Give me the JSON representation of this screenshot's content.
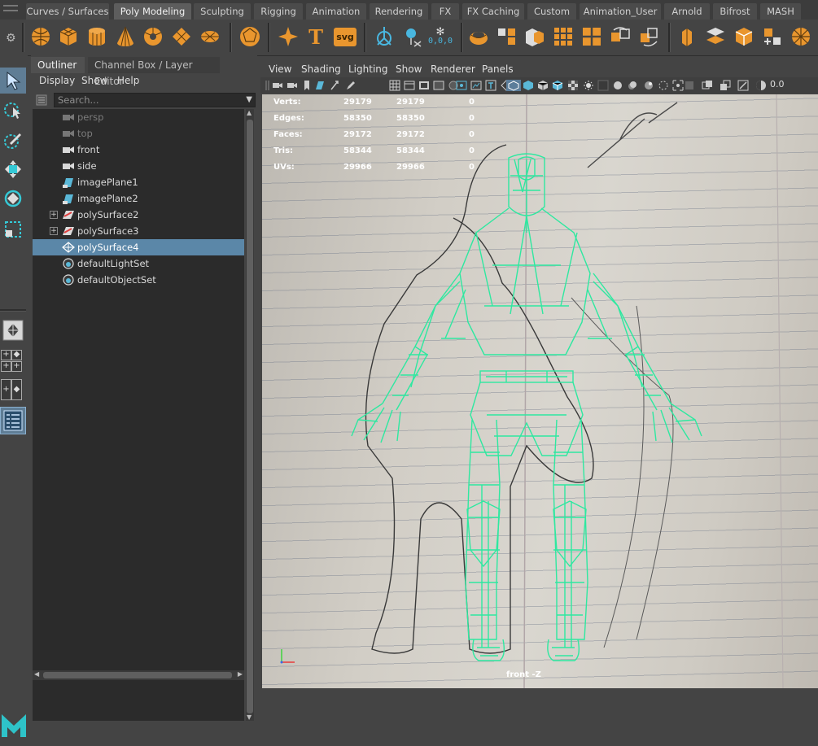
{
  "shelf": {
    "tabs": [
      "Curves / Surfaces",
      "Poly Modeling",
      "Sculpting",
      "Rigging",
      "Animation",
      "Rendering",
      "FX",
      "FX Caching",
      "Custom",
      "Animation_User",
      "Arnold",
      "Bifrost",
      "MASH"
    ],
    "active_tab": "Poly Modeling",
    "icon_text": {
      "type": "T",
      "svg": "svg",
      "coords": "0,0,0"
    },
    "accent_color": "#e9962e"
  },
  "outliner": {
    "tabs": [
      "Outliner",
      "Channel Box / Layer Editor"
    ],
    "menu": [
      "Display",
      "Show",
      "Help"
    ],
    "search_placeholder": "Search...",
    "items": [
      {
        "label": "persp",
        "icon": "camera-icon",
        "dim": true
      },
      {
        "label": "top",
        "icon": "camera-icon",
        "dim": true
      },
      {
        "label": "front",
        "icon": "camera-icon"
      },
      {
        "label": "side",
        "icon": "camera-icon"
      },
      {
        "label": "imagePlane1",
        "icon": "image-plane-icon"
      },
      {
        "label": "imagePlane2",
        "icon": "image-plane-icon"
      },
      {
        "label": "polySurface2",
        "icon": "poly-surface-icon",
        "expandable": true
      },
      {
        "label": "polySurface3",
        "icon": "poly-surface-icon",
        "expandable": true
      },
      {
        "label": "polySurface4",
        "icon": "poly-mesh-icon",
        "selected": true
      },
      {
        "label": "defaultLightSet",
        "icon": "set-icon"
      },
      {
        "label": "defaultObjectSet",
        "icon": "set-icon"
      }
    ],
    "selection_color": "#5b87a8"
  },
  "panel": {
    "menu": [
      "View",
      "Shading",
      "Lighting",
      "Show",
      "Renderer",
      "Panels"
    ],
    "toolbar_value": "0.0"
  },
  "hud": {
    "rows": [
      {
        "label": "Verts:",
        "v1": "29179",
        "v2": "29179",
        "v3": "0"
      },
      {
        "label": "Edges:",
        "v1": "58350",
        "v2": "58350",
        "v3": "0"
      },
      {
        "label": "Faces:",
        "v1": "29172",
        "v2": "29172",
        "v3": "0"
      },
      {
        "label": "Tris:",
        "v1": "58344",
        "v2": "58344",
        "v3": "0"
      },
      {
        "label": "UVs:",
        "v1": "29966",
        "v2": "29966",
        "v3": "0"
      }
    ],
    "camera_label": "front -Z",
    "wireframe_color": "#2ee8a0"
  }
}
